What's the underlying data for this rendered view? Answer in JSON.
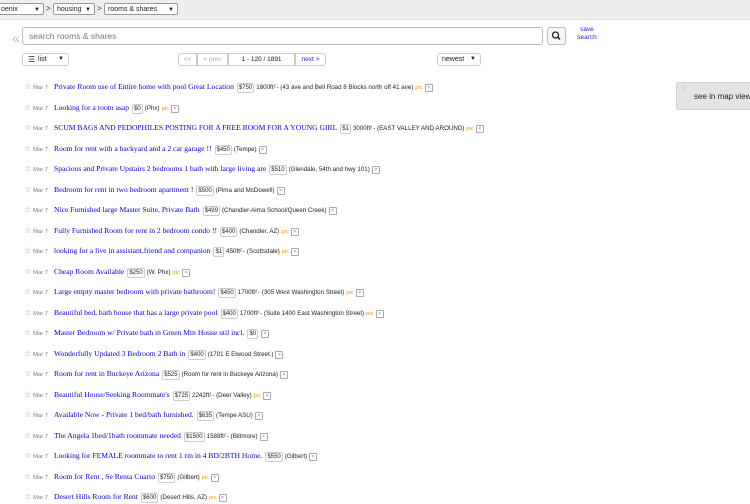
{
  "breadcrumbs": {
    "city": "oenix",
    "category": "housing",
    "subcategory": "rooms & shares",
    "separator": ">"
  },
  "search": {
    "placeholder": "search rooms & shares",
    "value": "",
    "save_label": "save search"
  },
  "toolbar": {
    "view_label": "list",
    "prev_first": "<<",
    "prev": "< prev",
    "range": "1 - 120 / 1891",
    "next": "next >",
    "sort_label": "newest"
  },
  "map": {
    "label": "see in map view"
  },
  "listings": [
    {
      "date": "Mar 7",
      "title": "Private Room use of Entire home with pool Great Location",
      "price": "$750",
      "sqft": "1800ft²",
      "hood": "- (43 ave and Bell Road 8 Blocks north off 41 ave)",
      "pic": "pic"
    },
    {
      "date": "Mar 7",
      "title": "Looking for a room asap",
      "price": "$0",
      "sqft": "",
      "hood": "(Phx)",
      "pic": "pic"
    },
    {
      "date": "Mar 7",
      "title": "SCUM BAGS AND PEDOPHILES POSTING FOR A FREE ROOM FOR A YOUNG GIRL",
      "price": "$1",
      "sqft": "3000ft²",
      "hood": "- (EAST VALLEY AND AROUND)",
      "pic": "pic"
    },
    {
      "date": "Mar 7",
      "title": "Room for rent with a backyard and a 2 car garage !!",
      "price": "$450",
      "sqft": "",
      "hood": "(Tempe)",
      "pic": ""
    },
    {
      "date": "Mar 7",
      "title": "Spacious and Private Upstairs 2 bedrooms 1 bath with large living are",
      "price": "$510",
      "sqft": "",
      "hood": "(Glendale, 54th and hwy 101)",
      "pic": ""
    },
    {
      "date": "Mar 7",
      "title": "Bedroom for rent in two bedroom apartment !",
      "price": "$500",
      "sqft": "",
      "hood": "(Pima and McDowell)",
      "pic": ""
    },
    {
      "date": "Mar 7",
      "title": "Nice Furnished large Master Suite, Private Bath",
      "price": "$499",
      "sqft": "",
      "hood": "(Chandler-Alma School/Queen Creek)",
      "pic": ""
    },
    {
      "date": "Mar 7",
      "title": "Fully Furnished Room for rent in 2 bedroom condo !!",
      "price": "$400",
      "sqft": "",
      "hood": "(Chandler, AZ)",
      "pic": "pic"
    },
    {
      "date": "Mar 7",
      "title": "looking for a live in assistant,friend and companion",
      "price": "$1",
      "sqft": "450ft²",
      "hood": "- (Scottsdale)",
      "pic": "pic"
    },
    {
      "date": "Mar 7",
      "title": "Cheap Room Available",
      "price": "$250",
      "sqft": "",
      "hood": "(W. Phx)",
      "pic": "pic"
    },
    {
      "date": "Mar 7",
      "title": "Large empty master bedroom with private bathroom!",
      "price": "$450",
      "sqft": "1700ft²",
      "hood": "- (305 West Washington Street)",
      "pic": "pic"
    },
    {
      "date": "Mar 7",
      "title": "Beautiful bed, bath house that has a large private pool",
      "price": "$400",
      "sqft": "1700ft²",
      "hood": "- (Suite 1400 East Washington Street)",
      "pic": "pic"
    },
    {
      "date": "Mar 7",
      "title": "Master Bedroom w/ Private bath in Green Mtn House util incl.",
      "price": "$0",
      "sqft": "",
      "hood": "",
      "pic": ""
    },
    {
      "date": "Mar 7",
      "title": "Wonderfully Updated 3 Bedroom 2 Bath in",
      "price": "$400",
      "sqft": "",
      "hood": "(1701 E Elwood Street.)",
      "pic": ""
    },
    {
      "date": "Mar 7",
      "title": "Room for rent in Buckeye Arizona",
      "price": "$525",
      "sqft": "",
      "hood": "(Room for rent in Buckeye Arizona)",
      "pic": ""
    },
    {
      "date": "Mar 7",
      "title": "Beautiful House/Seeking Roommate's",
      "price": "$725",
      "sqft": "2242ft²",
      "hood": "- (Deer Valley)",
      "pic": "pic"
    },
    {
      "date": "Mar 7",
      "title": "Available Now - Private 1 bed/bath furnished.",
      "price": "$635",
      "sqft": "",
      "hood": "(Tempe ASU)",
      "pic": ""
    },
    {
      "date": "Mar 7",
      "title": "The Angela 1bed/1bath roommate needed",
      "price": "$1500",
      "sqft": "1588ft²",
      "hood": "- (Biltmore)",
      "pic": ""
    },
    {
      "date": "Mar 7",
      "title": "Looking for FEMALE roommate to rent 1 rm in 4 BD/2BTH Home.",
      "price": "$550",
      "sqft": "",
      "hood": "(Gilbert)",
      "pic": ""
    },
    {
      "date": "Mar 7",
      "title": "Room for Rent , Se Renta Cuarto",
      "price": "$750",
      "sqft": "",
      "hood": "(Gilbert)",
      "pic": "pic"
    },
    {
      "date": "Mar 7",
      "title": "Desert Hills Room for Rent",
      "price": "$600",
      "sqft": "",
      "hood": "(Desert Hills, AZ)",
      "pic": "pic"
    }
  ]
}
